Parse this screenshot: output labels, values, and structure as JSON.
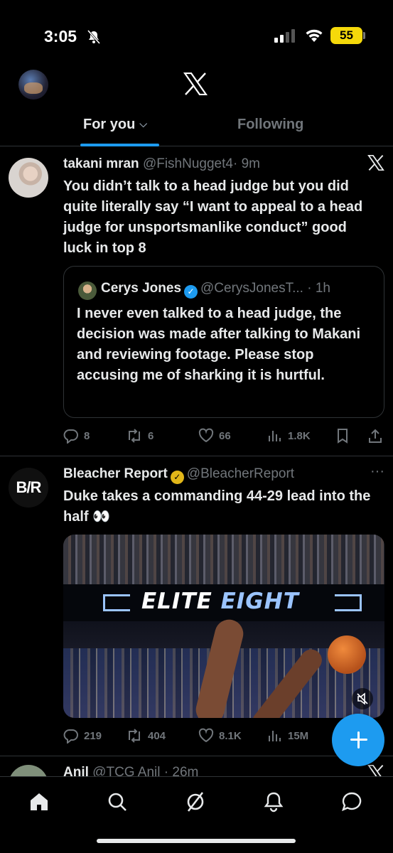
{
  "status_bar": {
    "time": "3:05",
    "battery": "55"
  },
  "header": {
    "logo": "X"
  },
  "tabs": [
    {
      "label": "For you",
      "active": true,
      "chevron": "⌵"
    },
    {
      "label": "Following",
      "active": false
    }
  ],
  "tweets": [
    {
      "name": "takani mran",
      "handle": "@FishNugget4",
      "time": "· 9m",
      "text": "You didn’t talk to a head judge but you did quite literally say “I want to appeal to a head judge for unsportsmanlike conduct” good luck in top 8",
      "corner": "X",
      "quote": {
        "name": "Cerys Jones",
        "handle": "@CerysJonesT...",
        "time": "· 1h",
        "text": "I never even talked to a head judge, the decision was made after talking to Makani and reviewing footage. Please stop accusing me of sharking it is hurtful."
      },
      "stats": {
        "replies": "8",
        "reposts": "6",
        "likes": "66",
        "views": "1.8K"
      }
    },
    {
      "name": "Bleacher Report",
      "handle": "@BleacherReport",
      "avatar_text": "B/R",
      "text": "Duke takes a commanding 44-29 lead into the half 👀",
      "corner": "···",
      "media": {
        "banner_word1": "ELITE",
        "banner_word2": "EIGHT"
      },
      "stats": {
        "replies": "219",
        "reposts": "404",
        "likes": "8.1K",
        "views": "15M"
      }
    },
    {
      "name": "Anil",
      "handle": "@TCG Anil",
      "time": "· 26m",
      "corner": "X"
    }
  ],
  "colors": {
    "accent": "#1d9bf0",
    "background": "#000000",
    "muted": "#71767b",
    "gold_check": "#e2b719"
  }
}
